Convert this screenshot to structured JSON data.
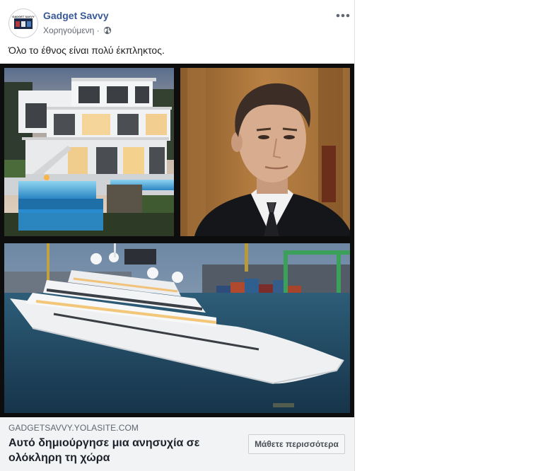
{
  "post": {
    "page_name": "Gadget Savvy",
    "sponsored_label": "Χορηγούμενη",
    "separator": "·",
    "privacy_icon": "globe-icon",
    "options_icon": "more-options-icon",
    "text": "Όλο το έθνος είναι πολύ έκπληκτος.",
    "avatar_text": "GADGET SAVVY"
  },
  "media": {
    "images": [
      "mansion-photo",
      "man-portrait-photo",
      "superyacht-photo"
    ]
  },
  "link_preview": {
    "domain": "GADGETSAVVY.YOLASITE.COM",
    "headline": "Αυτό δημιούργησε μια ανησυχία σε ολόκληρη τη χώρα",
    "cta_label": "Μάθετε περισσότερα"
  },
  "colors": {
    "page_name": "#385898",
    "meta_text": "#606770",
    "link_box_bg": "#f2f3f5",
    "media_border": "#0d0d0d"
  }
}
